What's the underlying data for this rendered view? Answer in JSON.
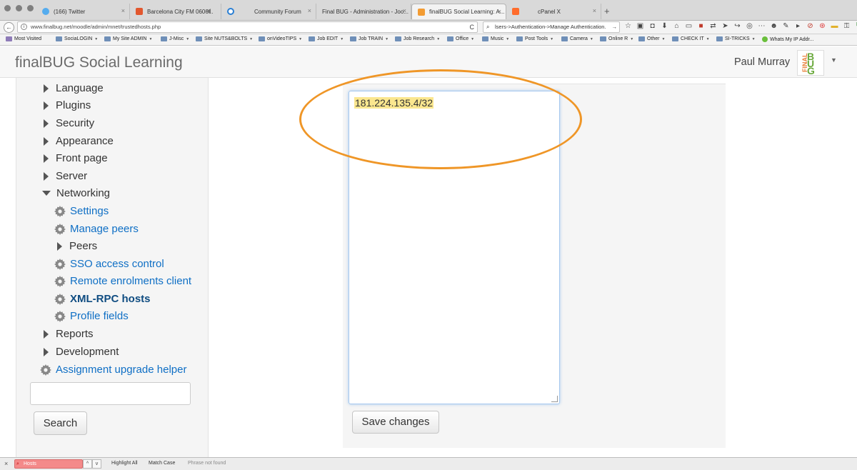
{
  "browser": {
    "tabs": [
      {
        "label": "(166) Twitter",
        "favicon_color": "#55acee"
      },
      {
        "label": "Barcelona City FM 0606...",
        "favicon_color": "#e2572e"
      },
      {
        "label": "",
        "favicon_color": "#c9c9c9"
      },
      {
        "label": "Community Forum",
        "favicon_color": "#e0e0e0"
      },
      {
        "label": "Final BUG - Administration - Joo...",
        "favicon_color": "#e0e0e0"
      },
      {
        "label": "finalBUG Social Learning: A...",
        "favicon_color": "#f39c33"
      },
      {
        "label": "cPanel X",
        "favicon_color": "#ff6c2c"
      }
    ],
    "tab_close": "×",
    "new_tab": "+",
    "back": "←",
    "url": "www.finalbug.net/moodle/admin/mnet/trustedhosts.php",
    "reload": "C",
    "search_text": "lsers->Authentication->Manage Authentication.",
    "search_arrow": "→",
    "bookmarks": [
      {
        "label": "Most Visited"
      },
      {
        "label": "SociaLOGIN"
      },
      {
        "label": "My Site ADMIN"
      },
      {
        "label": "J-Misc"
      },
      {
        "label": "Site NUTS&BOLTS"
      },
      {
        "label": "onVideoTIPS"
      },
      {
        "label": "Job EDIT"
      },
      {
        "label": "Job TRAIN"
      },
      {
        "label": "Job Research"
      },
      {
        "label": "Office"
      },
      {
        "label": "Music"
      },
      {
        "label": "Post Tools"
      },
      {
        "label": "Camera"
      },
      {
        "label": "Online R"
      },
      {
        "label": "Other"
      },
      {
        "label": "CHECK IT"
      },
      {
        "label": "SI-TRICKS"
      },
      {
        "label": "Whats My IP Addr..."
      }
    ]
  },
  "header": {
    "site_name": "finalBUG Social Learning",
    "user_name": "Paul Murray",
    "avatar_text_top": "FINAL",
    "avatar_text_main": "BUG"
  },
  "sidebar": {
    "items": [
      {
        "label": "Language"
      },
      {
        "label": "Plugins"
      },
      {
        "label": "Security"
      },
      {
        "label": "Appearance"
      },
      {
        "label": "Front page"
      },
      {
        "label": "Server"
      },
      {
        "label": "Networking"
      },
      {
        "label": "Settings"
      },
      {
        "label": "Manage peers"
      },
      {
        "label": "Peers"
      },
      {
        "label": "SSO access control"
      },
      {
        "label": "Remote enrolments client"
      },
      {
        "label": "XML-RPC hosts"
      },
      {
        "label": "Profile fields"
      },
      {
        "label": "Reports"
      },
      {
        "label": "Development"
      },
      {
        "label": "Assignment upgrade helper"
      }
    ],
    "search_value": "",
    "search_button": "Search"
  },
  "main": {
    "hosts_value": "181.224.135.4/32",
    "save_button": "Save changes",
    "highlight_color": "#ef9627"
  },
  "findbar": {
    "close": "×",
    "query": "Hosts",
    "prev": "^",
    "next": "v",
    "highlight_all": "Highlight All",
    "match_case": "Match Case",
    "status": "Phrase not found"
  }
}
